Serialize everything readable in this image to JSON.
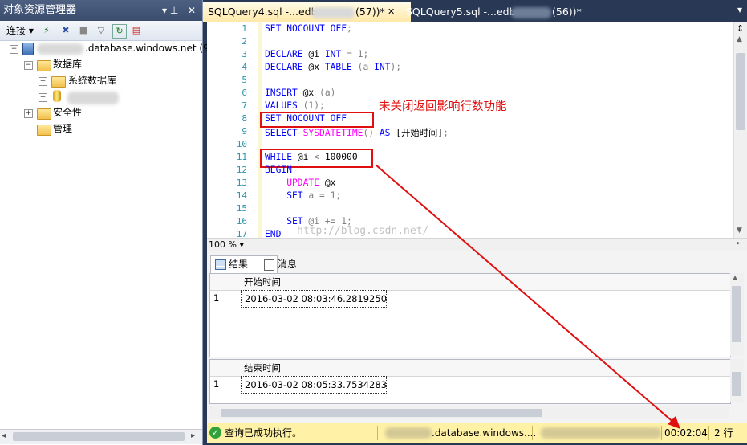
{
  "object_explorer": {
    "title": "对象资源管理器",
    "pin": "▾ ᵖ",
    "close": "✕",
    "toolbar_connect": "连接",
    "server_suffix": ".database.windows.net (9",
    "databases_label": "数据库",
    "system_db_label": "系统数据库",
    "security_label": "安全性",
    "management_label": "管理"
  },
  "tabs": [
    {
      "label": "SQLQuery4.sql -...edb",
      "suffix": "(57))*",
      "close": "✕"
    },
    {
      "label": "SQLQuery5.sql -...edb",
      "suffix": "(56))*"
    }
  ],
  "editor": {
    "line_numbers": [
      "1",
      "2",
      "3",
      "4",
      "5",
      "6",
      "7",
      "8",
      "9",
      "10",
      "11",
      "12",
      "13",
      "14",
      "15",
      "16",
      "17"
    ],
    "lines": [
      [
        {
          "t": "SET NOCOUNT OFF",
          "c": "kw"
        },
        {
          "t": ";",
          "c": "gr"
        }
      ],
      [],
      [
        {
          "t": "DECLARE",
          "c": "kw"
        },
        {
          "t": " @i ",
          "c": "st"
        },
        {
          "t": "INT",
          "c": "kw"
        },
        {
          "t": " = 1;",
          "c": "gr"
        }
      ],
      [
        {
          "t": "DECLARE",
          "c": "kw"
        },
        {
          "t": " @x ",
          "c": "st"
        },
        {
          "t": "TABLE",
          "c": "kw"
        },
        {
          "t": " (a ",
          "c": "gr"
        },
        {
          "t": "INT",
          "c": "kw"
        },
        {
          "t": ");",
          "c": "gr"
        }
      ],
      [],
      [
        {
          "t": "INSERT",
          "c": "kw"
        },
        {
          "t": " @x ",
          "c": "st"
        },
        {
          "t": "(a)",
          "c": "gr"
        }
      ],
      [
        {
          "t": "VALUES",
          "c": "kw"
        },
        {
          "t": " (1);",
          "c": "gr"
        }
      ],
      [
        {
          "t": "SET NOCOUNT OFF",
          "c": "kw"
        }
      ],
      [
        {
          "t": "SELECT",
          "c": "kw"
        },
        {
          "t": " ",
          "c": "st"
        },
        {
          "t": "SYSDATETIME",
          "c": "fn"
        },
        {
          "t": "() ",
          "c": "gr"
        },
        {
          "t": "AS",
          "c": "kw"
        },
        {
          "t": " [开始时间]",
          "c": "st"
        },
        {
          "t": ";",
          "c": "gr"
        }
      ],
      [],
      [
        {
          "t": "WHILE",
          "c": "kw"
        },
        {
          "t": " @i ",
          "c": "st"
        },
        {
          "t": "< ",
          "c": "gr"
        },
        {
          "t": "100000",
          "c": "st"
        }
      ],
      [
        {
          "t": "BEGIN",
          "c": "kw"
        }
      ],
      [
        {
          "t": "    UPDATE",
          "c": "fn"
        },
        {
          "t": " @x",
          "c": "st"
        }
      ],
      [
        {
          "t": "    SET",
          "c": "kw"
        },
        {
          "t": " a = 1;",
          "c": "gr"
        }
      ],
      [],
      [
        {
          "t": "    SET",
          "c": "kw"
        },
        {
          "t": " @i += 1;",
          "c": "gr"
        }
      ],
      [
        {
          "t": "END",
          "c": "kw"
        }
      ]
    ],
    "zoom": "100 %",
    "annotation": "未关闭返回影响行数功能",
    "watermark": "http://blog.csdn.net/"
  },
  "results": {
    "tab_results": "结果",
    "tab_messages": "消息",
    "grid1": {
      "header": "开始时间",
      "row_num": "1",
      "value": "2016-03-02 08:03:46.2819250"
    },
    "grid2": {
      "header": "结束时间",
      "row_num": "1",
      "value": "2016-03-02 08:05:33.7534283"
    }
  },
  "status": {
    "message": "查询已成功执行。",
    "server": ".database.windows....",
    "elapsed": "00:02:04",
    "rows": "2 行"
  },
  "colors": {
    "annotation_red": "#e01010",
    "status_bg": "#fff1a6",
    "keyword_blue": "#0000ff",
    "function_pink": "#ff00ff"
  }
}
